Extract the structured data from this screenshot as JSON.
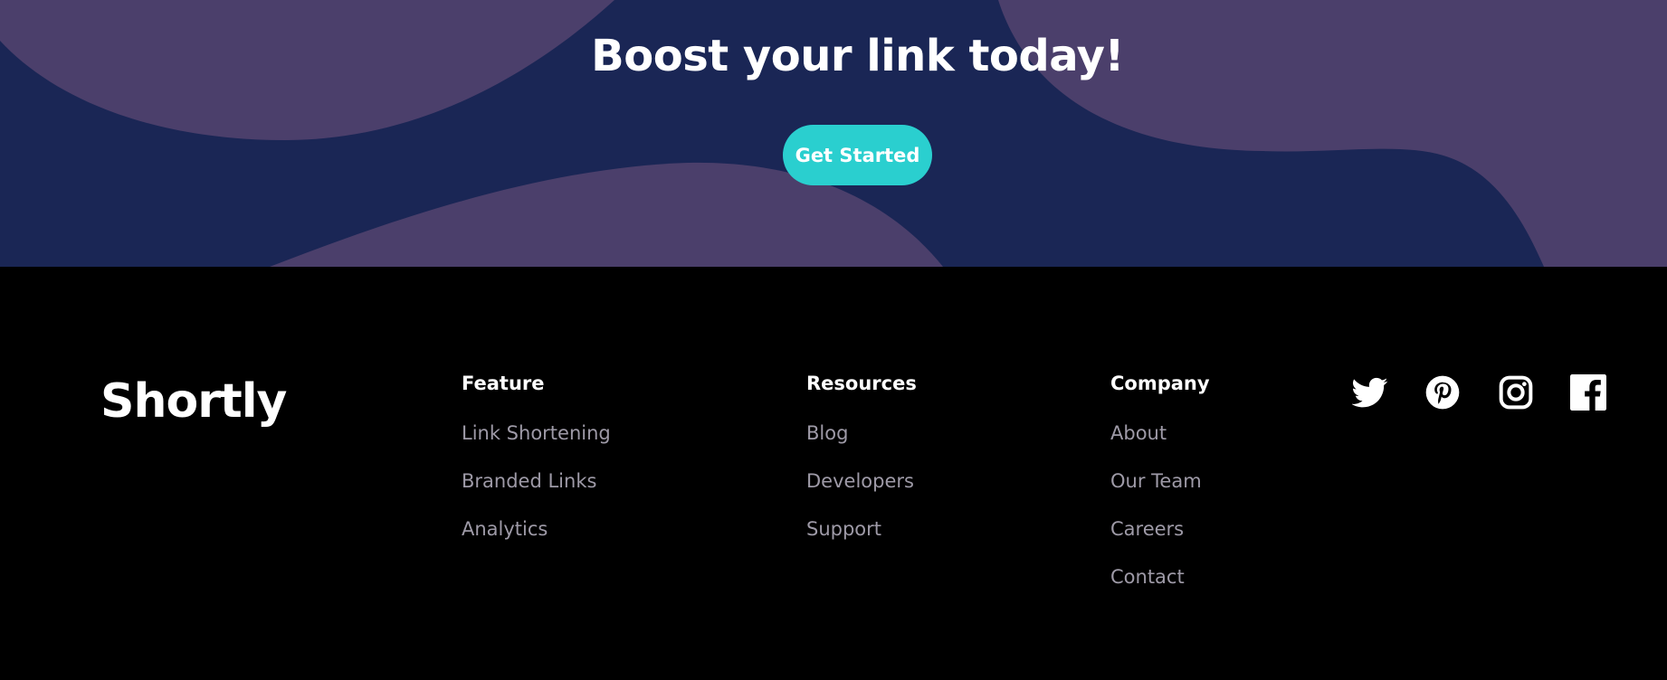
{
  "cta": {
    "title": "Boost your link today!",
    "button_label": "Get Started",
    "colors": {
      "background": "#1a2655",
      "shape": "#4b3f6b",
      "button": "#2acfcf"
    }
  },
  "footer": {
    "logo": "Shortly",
    "columns": [
      {
        "heading": "Feature",
        "links": [
          "Link Shortening",
          "Branded Links",
          "Analytics"
        ]
      },
      {
        "heading": "Resources",
        "links": [
          "Blog",
          "Developers",
          "Support"
        ]
      },
      {
        "heading": "Company",
        "links": [
          "About",
          "Our Team",
          "Careers",
          "Contact"
        ]
      }
    ],
    "social_icons": [
      "twitter-icon",
      "pinterest-icon",
      "instagram-icon",
      "facebook-icon"
    ],
    "colors": {
      "background": "#000000",
      "heading": "#ffffff",
      "link": "#9e9aa7"
    }
  }
}
